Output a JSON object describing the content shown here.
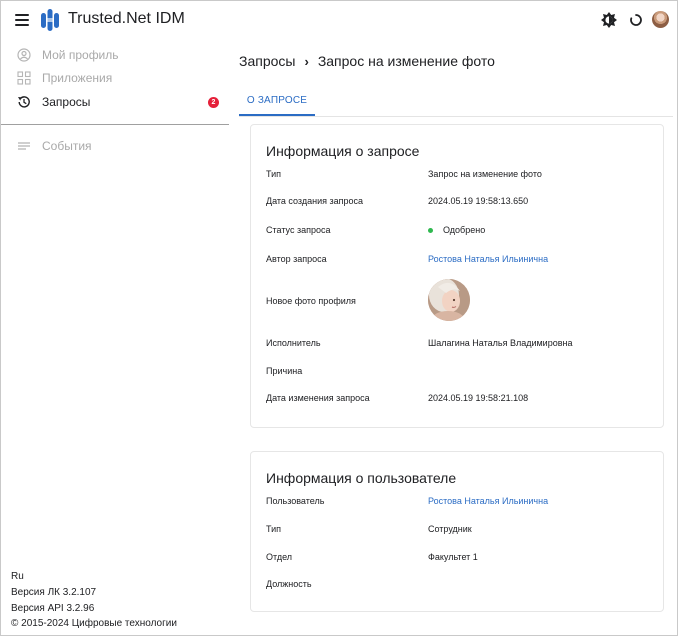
{
  "header": {
    "app_title": "Trusted.Net IDM",
    "brand_color": "#2b6cc4"
  },
  "sidebar": {
    "items": [
      {
        "label": "Мой профиль",
        "icon": "user-circle-icon"
      },
      {
        "label": "Приложения",
        "icon": "apps-grid-icon"
      },
      {
        "label": "Запросы",
        "icon": "history-icon",
        "badge": "2",
        "active": true
      },
      {
        "label": "События",
        "icon": "list-icon"
      }
    ],
    "footer": {
      "lang": "Ru",
      "version_lk": "Версия ЛК 3.2.107",
      "version_api": "Версия API 3.2.96",
      "copyright": "© 2015-2024 Цифровые технологии"
    }
  },
  "breadcrumb": {
    "parent": "Запросы",
    "separator": "›",
    "current": "Запрос на изменение фото"
  },
  "tabs": [
    {
      "label": "О ЗАПРОСЕ",
      "active": true
    }
  ],
  "request_info": {
    "title": "Информация о запросе",
    "rows": [
      {
        "label": "Тип",
        "value": "Запрос на изменение фото"
      },
      {
        "label": "Дата создания запроса",
        "value": "2024.05.19 19:58:13.650"
      },
      {
        "label": "Статус запроса",
        "value": "Одобрено",
        "status_color": "#2fb84f"
      },
      {
        "label": "Автор запроса",
        "value": "Ростова Наталья Ильинична"
      },
      {
        "label": "Новое фото профиля",
        "value": ""
      },
      {
        "label": "Исполнитель",
        "value": "Шалагина Наталья Владимировна"
      },
      {
        "label": "Причина",
        "value": ""
      },
      {
        "label": "Дата изменения запроса",
        "value": "2024.05.19 19:58:21.108"
      }
    ]
  },
  "user_info": {
    "title": "Информация о пользователе",
    "rows": [
      {
        "label": "Пользователь",
        "value": "Ростова Наталья Ильинична"
      },
      {
        "label": "Тип",
        "value": "Сотрудник"
      },
      {
        "label": "Отдел",
        "value": "Факультет 1"
      },
      {
        "label": "Должность",
        "value": ""
      }
    ]
  }
}
